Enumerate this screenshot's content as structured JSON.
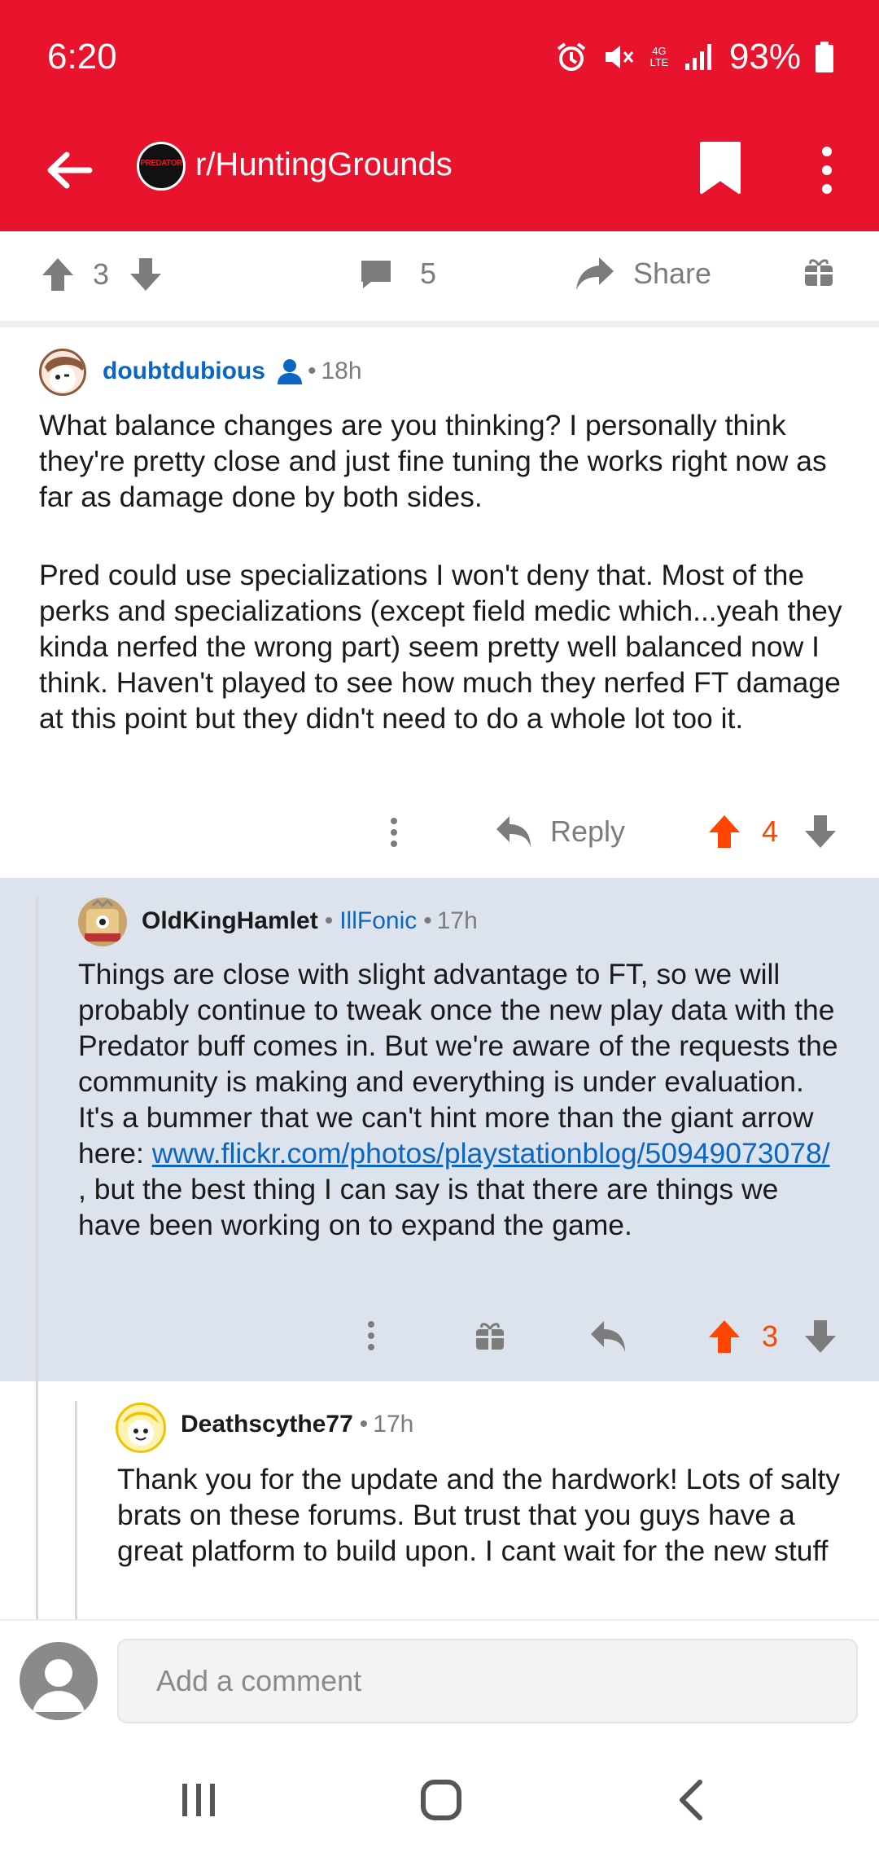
{
  "status_bar": {
    "time": "6:20",
    "battery": "93%",
    "network": "4G LTE"
  },
  "app_bar": {
    "subreddit": "r/HuntingGrounds",
    "subreddit_icon_text": "PREDATOR"
  },
  "post_actions": {
    "upvotes": "3",
    "comments": "5",
    "share_label": "Share"
  },
  "comments": [
    {
      "author": "doubtdubious",
      "is_op": true,
      "age": "18h",
      "paragraphs": [
        "What balance changes are you thinking? I personally think they're pretty close and just fine tuning the works right now as far as damage done by both sides.",
        "Pred could use specializations I won't deny that. Most of the perks and specializations (except field medic which...yeah they kinda nerfed the wrong part) seem pretty well balanced now I think. Haven't played to see how much they nerfed FT damage at this point but they didn't need to do a whole lot too it."
      ],
      "reply_label": "Reply",
      "score": "4"
    },
    {
      "author": "OldKingHamlet",
      "flair": "IllFonic",
      "age": "17h",
      "text_before_link": "Things are close with slight advantage to FT, so we will probably continue to tweak once the new play data with the Predator buff comes in. But we're aware of the requests the community is making and everything is under evaluation. It's a bummer that we can't hint more than the giant arrow here: ",
      "link": "www.flickr.com/photos/playstationblog/50949073078/",
      "text_after_link": " , but the best thing I can say is that there are things we have been working on to expand the game.",
      "score": "3"
    },
    {
      "author": "Deathscythe77",
      "age": "17h",
      "text": "Thank you for the update and the hardwork! Lots of salty brats on these forums. But trust that you guys have a great platform to build upon. I cant wait for the new stuff"
    }
  ],
  "composer": {
    "placeholder": "Add a comment"
  },
  "colors": {
    "brand_red": "#e8132c",
    "upvote_orange": "#ff4500",
    "highlight_bg": "#dde3ed",
    "link_blue": "#0a66c2"
  }
}
